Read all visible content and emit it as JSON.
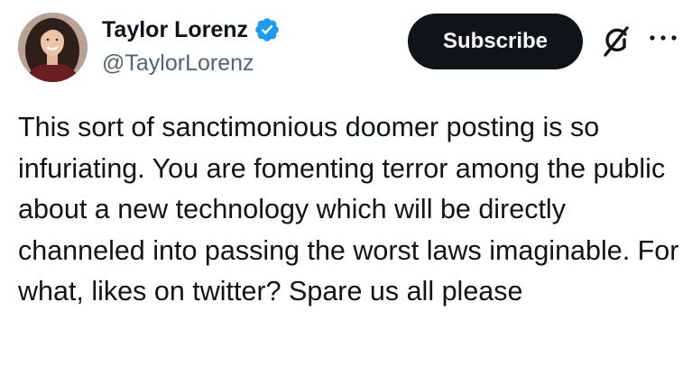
{
  "author": {
    "display_name": "Taylor Lorenz",
    "handle": "@TaylorLorenz",
    "verified": true,
    "verified_color": "#1d9bf0"
  },
  "actions": {
    "subscribe_label": "Subscribe",
    "grok_icon": "grok-icon",
    "more_icon": "more-icon"
  },
  "tweet": {
    "text": "This sort of sanctimonious doomer posting is so infuriating. You are fomenting terror among the public about a new technology which will be directly channeled into passing the worst laws imaginable. For what, likes on twitter? Spare us all please"
  },
  "colors": {
    "text_primary": "#0f1419",
    "text_secondary": "#536471",
    "button_bg": "#0f1419"
  }
}
